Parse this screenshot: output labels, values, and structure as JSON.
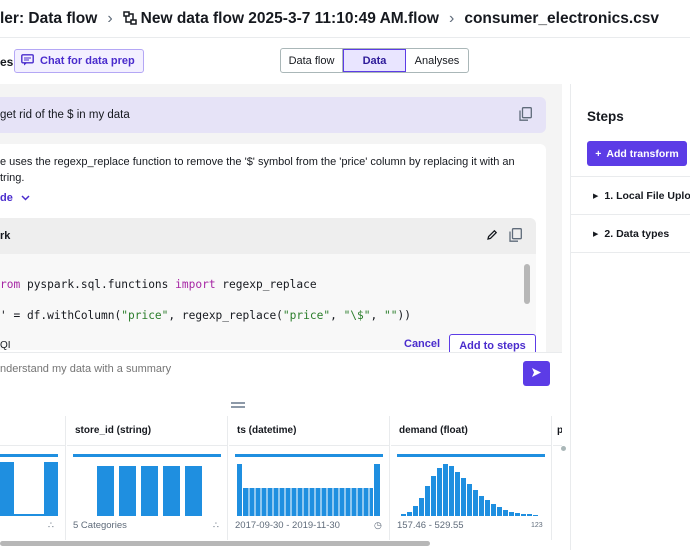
{
  "breadcrumb": {
    "items": [
      "ler: Data flow",
      "New data flow 2025-3-7 11:10:49 AM.flow",
      "consumer_electronics.csv"
    ]
  },
  "toolbar": {
    "left_fragment": "es",
    "chat_button": "Chat for data prep",
    "tabs": [
      {
        "label": "Data flow",
        "active": false
      },
      {
        "label": "Data",
        "active": true
      },
      {
        "label": "Analyses",
        "active": false
      }
    ]
  },
  "chat": {
    "user_message": "get rid of the $ in my data",
    "response_line1": "e uses the regexp_replace function to remove the '$' symbol from the 'price' column by replacing it with an",
    "response_line2": "tring.",
    "code_toggle": "de",
    "code_language": "rk",
    "code_line1_kw1": "rom",
    "code_line1_mod": " pyspark.sql.functions ",
    "code_line1_kw2": "import",
    "code_line1_fn": " regexp_replace",
    "code_line2_pre": "' = df.withColumn(",
    "code_line2_s1": "\"price\"",
    "code_line2_mid": ", regexp_replace(",
    "code_line2_s2": "\"price\"",
    "code_line2_comma": ", ",
    "code_line2_s3": "\"\\$\"",
    "code_line2_comma2": ", ",
    "code_line2_s4": "\"\"",
    "code_line2_end": "))",
    "ai_label": "QI",
    "cancel": "Cancel",
    "add_to_steps": "Add to steps",
    "prompt_placeholder": "nderstand my data with a summary"
  },
  "steps": {
    "title": "Steps",
    "add_transform": "Add transform",
    "items": [
      "1. Local File Uplo",
      "2. Data types"
    ]
  },
  "grid": {
    "columns": [
      {
        "header": "",
        "footer": ""
      },
      {
        "header": "store_id (string)",
        "footer": "5 Categories"
      },
      {
        "header": "ts (datetime)",
        "footer": "2017-09-30 - 2019-11-30"
      },
      {
        "header": "demand (float)",
        "footer": "157.46 - 529.55",
        "foot_badge": "123"
      },
      {
        "header": "pr",
        "footer": ""
      }
    ]
  },
  "colors": {
    "accent": "#5c3ce6",
    "bar": "#1f8fe0"
  },
  "icons": [
    "flow-icon",
    "chat-icon",
    "copy-icon",
    "chevron-down-icon",
    "edit-icon",
    "send-icon",
    "plus-icon",
    "caret-right-icon",
    "category-icon",
    "clock-icon",
    "drag-handle-icon"
  ]
}
